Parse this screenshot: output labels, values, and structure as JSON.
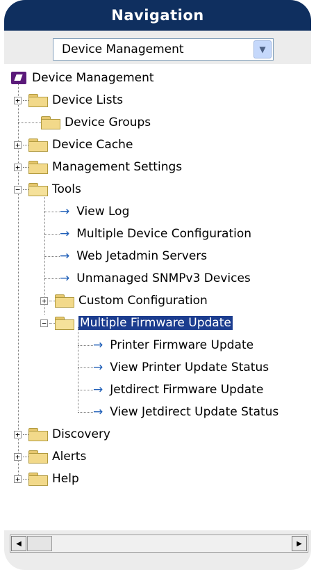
{
  "header": {
    "title": "Navigation"
  },
  "dropdown": {
    "value": "Device Management"
  },
  "tree": {
    "root": "Device Management",
    "items": {
      "device_lists": "Device Lists",
      "device_groups": "Device Groups",
      "device_cache": "Device Cache",
      "management_settings": "Management Settings",
      "tools": "Tools",
      "view_log": "View Log",
      "multiple_device_configuration": "Multiple Device Configuration",
      "web_jetadmin_servers": "Web Jetadmin Servers",
      "unmanaged_snmpv3": "Unmanaged SNMPv3 Devices",
      "custom_configuration": "Custom Configuration",
      "multiple_firmware_update": "Multiple Firmware Update",
      "printer_firmware_update": "Printer Firmware Update",
      "view_printer_update_status": "View Printer Update Status",
      "jetdirect_firmware_update": "Jetdirect Firmware Update",
      "view_jetdirect_update_status": "View Jetdirect Update Status",
      "discovery": "Discovery",
      "alerts": "Alerts",
      "help": "Help"
    },
    "selected": "Multiple Firmware Update"
  },
  "colors": {
    "header": "#0f2f5f",
    "selection": "#1c3d8f",
    "arrow": "#1f5fb8"
  }
}
